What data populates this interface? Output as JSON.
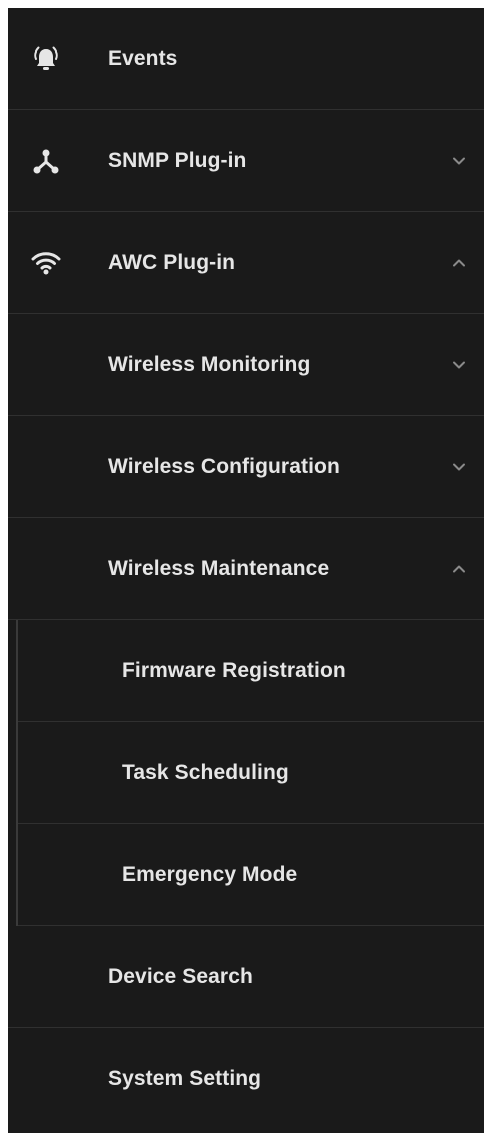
{
  "menu": {
    "events": {
      "label": "Events",
      "icon": "alarm-bell-icon"
    },
    "snmp": {
      "label": "SNMP Plug-in",
      "icon": "network-topology-icon",
      "state": "collapsed"
    },
    "awc": {
      "label": "AWC Plug-in",
      "icon": "wifi-icon",
      "state": "expanded"
    },
    "wireless_monitoring": {
      "label": "Wireless Monitoring",
      "state": "collapsed"
    },
    "wireless_configuration": {
      "label": "Wireless Configuration",
      "state": "collapsed"
    },
    "wireless_maintenance": {
      "label": "Wireless Maintenance",
      "state": "expanded"
    },
    "firmware_registration": {
      "label": "Firmware Registration"
    },
    "task_scheduling": {
      "label": "Task Scheduling"
    },
    "emergency_mode": {
      "label": "Emergency Mode"
    },
    "device_search": {
      "label": "Device Search"
    },
    "system_setting": {
      "label": "System Setting"
    }
  },
  "colors": {
    "background": "#1a1a1a",
    "text": "#e6e6e6",
    "divider": "#303030",
    "chevron": "#8a8a8a"
  }
}
